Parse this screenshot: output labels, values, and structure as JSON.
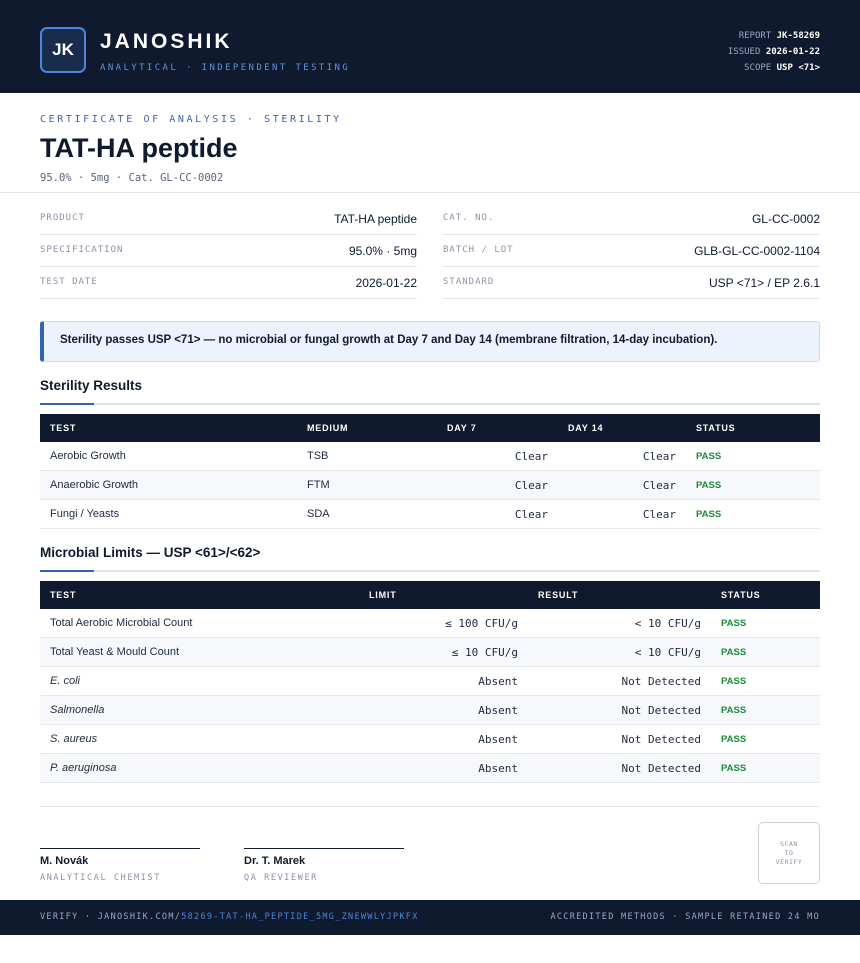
{
  "header": {
    "logo_initials": "JK",
    "brand": "JANOSHIK",
    "tagline": "ANALYTICAL · INDEPENDENT TESTING",
    "meta": [
      {
        "label": "REPORT",
        "value": "JK-58269"
      },
      {
        "label": "ISSUED",
        "value": "2026-01-22"
      },
      {
        "label": "SCOPE",
        "value": "USP <71>"
      }
    ]
  },
  "doc": {
    "eyebrow": "CERTIFICATE OF ANALYSIS · STERILITY",
    "title": "TAT-HA peptide",
    "subtitle": "95.0% · 5mg  ·  Cat. GL-CC-0002"
  },
  "info": {
    "left": [
      {
        "label": "PRODUCT",
        "value": "TAT-HA peptide"
      },
      {
        "label": "SPECIFICATION",
        "value": "95.0% · 5mg"
      },
      {
        "label": "TEST DATE",
        "value": "2026-01-22"
      }
    ],
    "right": [
      {
        "label": "CAT. NO.",
        "value": "GL-CC-0002"
      },
      {
        "label": "BATCH / LOT",
        "value": "GLB-GL-CC-0002-1104"
      },
      {
        "label": "STANDARD",
        "value": "USP <71> / EP 2.6.1"
      }
    ]
  },
  "summary": "Sterility passes USP <71> — no microbial or fungal growth at Day 7 and Day 14 (membrane filtration, 14-day incubation).",
  "sterility": {
    "title": "Sterility Results",
    "headers": [
      "TEST",
      "MEDIUM",
      "DAY 7",
      "DAY 14",
      "STATUS"
    ],
    "rows": [
      {
        "test": "Aerobic Growth",
        "medium": "TSB",
        "day7": "Clear",
        "day14": "Clear",
        "status": "PASS"
      },
      {
        "test": "Anaerobic Growth",
        "medium": "FTM",
        "day7": "Clear",
        "day14": "Clear",
        "status": "PASS"
      },
      {
        "test": "Fungi / Yeasts",
        "medium": "SDA",
        "day7": "Clear",
        "day14": "Clear",
        "status": "PASS"
      }
    ]
  },
  "microbial": {
    "title": "Microbial Limits — USP <61>/<62>",
    "headers": [
      "TEST",
      "LIMIT",
      "RESULT",
      "STATUS"
    ],
    "rows": [
      {
        "test": "Total Aerobic Microbial Count",
        "limit": "≤ 100 CFU/g",
        "result": "< 10 CFU/g",
        "status": "PASS"
      },
      {
        "test": "Total Yeast & Mould Count",
        "limit": "≤ 10 CFU/g",
        "result": "< 10 CFU/g",
        "status": "PASS"
      },
      {
        "test": "E. coli",
        "limit": "Absent",
        "result": "Not Detected",
        "status": "PASS"
      },
      {
        "test": "Salmonella",
        "limit": "Absent",
        "result": "Not Detected",
        "status": "PASS"
      },
      {
        "test": "S. aureus",
        "limit": "Absent",
        "result": "Not Detected",
        "status": "PASS"
      },
      {
        "test": "P. aeruginosa",
        "limit": "Absent",
        "result": "Not Detected",
        "status": "PASS"
      }
    ]
  },
  "signatures": [
    {
      "name": "M. Novák",
      "role": "ANALYTICAL CHEMIST"
    },
    {
      "name": "Dr. T. Marek",
      "role": "QA REVIEWER"
    }
  ],
  "qr_label": [
    "SCAN",
    "TO",
    "VERIFY"
  ],
  "footer": {
    "verify_prefix": "VERIFY · JANOSHIK.COM/",
    "verify_path": "58269-TAT-HA_PEPTIDE_5MG_ZNEWWLYJPKFX",
    "right": "ACCREDITED METHODS · SAMPLE RETAINED 24 MO"
  }
}
